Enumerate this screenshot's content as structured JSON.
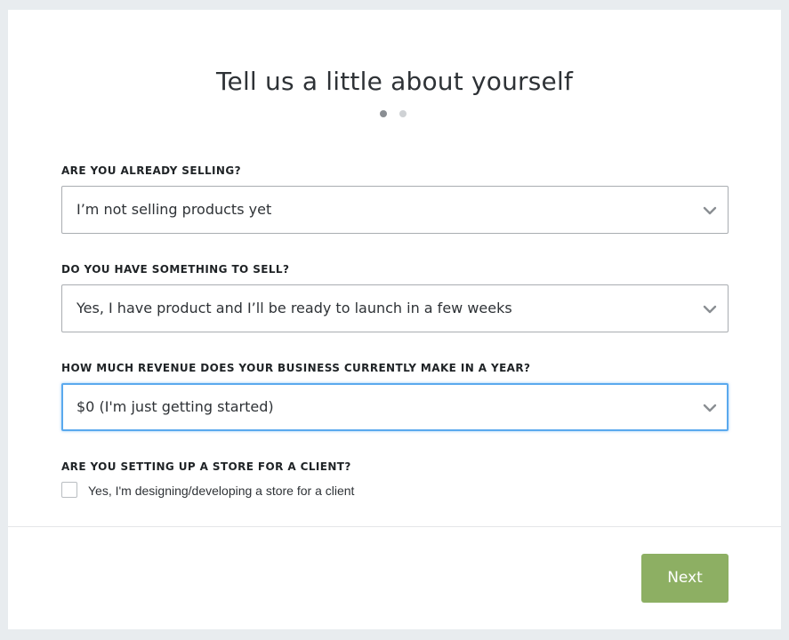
{
  "header": {
    "title": "Tell us a little about yourself",
    "steps_total": 2,
    "current_step": 1
  },
  "form": {
    "selling": {
      "label": "ARE YOU ALREADY SELLING?",
      "value": "I’m not selling products yet"
    },
    "something_to_sell": {
      "label": "DO YOU HAVE SOMETHING TO SELL?",
      "value": "Yes, I have product and I’ll be ready to launch in a few weeks"
    },
    "revenue": {
      "label": "HOW MUCH REVENUE DOES YOUR BUSINESS CURRENTLY MAKE IN A YEAR?",
      "value": "$0 (I'm just getting started)",
      "focused": true
    },
    "client_store": {
      "label": "ARE YOU SETTING UP A STORE FOR A CLIENT?",
      "checkbox_label": "Yes, I'm designing/developing a store for a client",
      "checked": false
    }
  },
  "footer": {
    "next_label": "Next"
  },
  "colors": {
    "accent_button": "#8daf63",
    "focus_ring": "#5aa9ee",
    "page_background": "#e8ecef"
  },
  "icons": {
    "select_arrow": "chevron-down-icon"
  }
}
